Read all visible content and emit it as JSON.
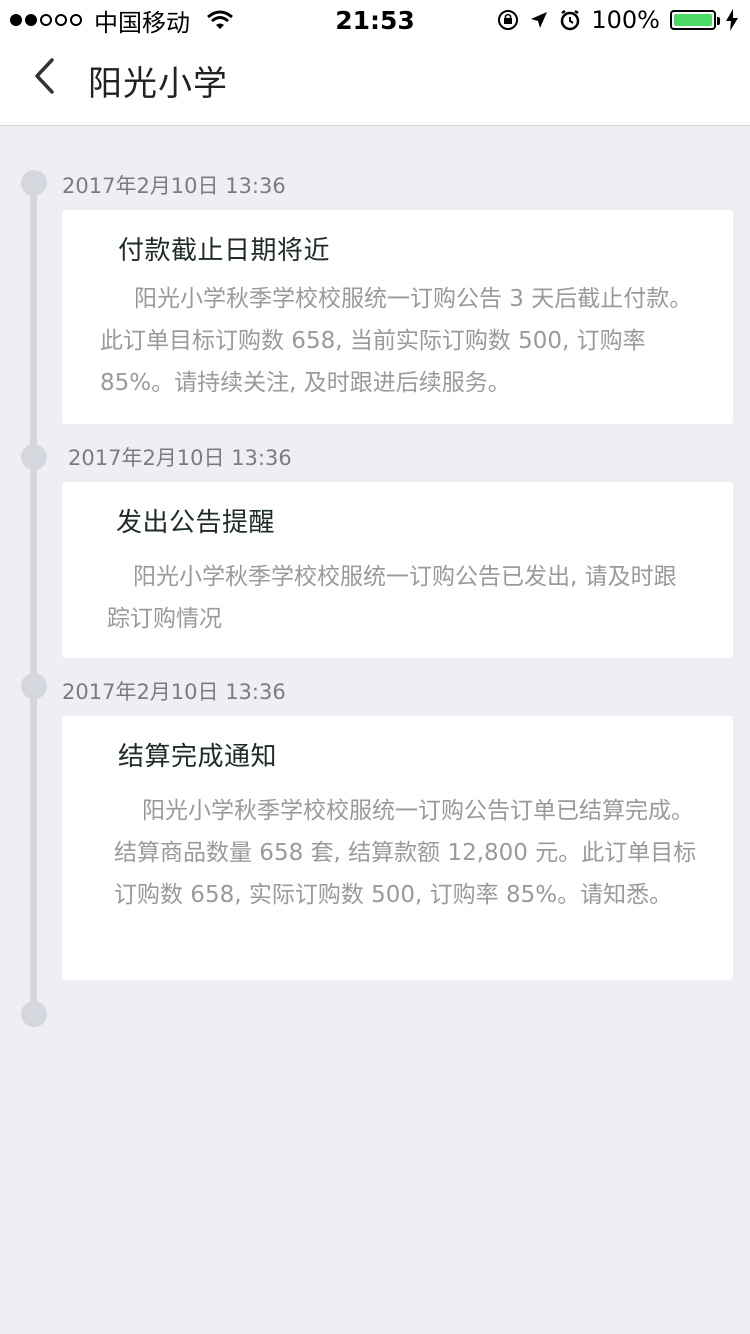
{
  "status_bar": {
    "carrier": "中国移动",
    "time": "21:53",
    "battery_percent": "100%",
    "battery_level": 1.0,
    "battery_color": "#4cd964",
    "icons": [
      "signal-icon",
      "wifi-icon",
      "orientation-lock-icon",
      "location-icon",
      "alarm-icon",
      "battery-icon",
      "charging-icon"
    ]
  },
  "nav": {
    "title": "阳光小学",
    "back_icon": "chevron-left-icon"
  },
  "timeline": [
    {
      "timestamp": "2017年2月10日 13:36",
      "title": "付款截止日期将近",
      "body": "阳光小学秋季学校校服统一订购公告 3 天后截止付款。此订单目标订购数 658, 当前实际订购数 500, 订购率 85%。请持续关注, 及时跟进后续服务。"
    },
    {
      "timestamp": "2017年2月10日 13:36",
      "title": "发出公告提醒",
      "body": "阳光小学秋季学校校服统一订购公告已发出, 请及时跟踪订购情况"
    },
    {
      "timestamp": "2017年2月10日 13:36",
      "title": "结算完成通知",
      "body": "阳光小学秋季学校校服统一订购公告订单已结算完成。结算商品数量 658 套, 结算款额 12,800 元。此订单目标订购数 658, 实际订购数 500, 订购率 85%。请知悉。"
    }
  ]
}
